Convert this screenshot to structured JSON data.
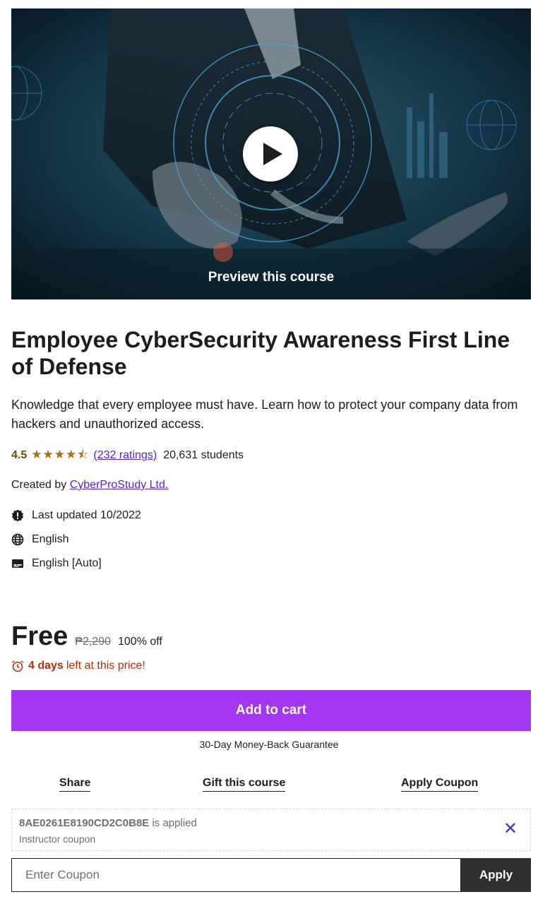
{
  "preview": {
    "label": "Preview this course"
  },
  "course": {
    "title": "Employee CyberSecurity Awareness First Line of Defense",
    "subtitle": "Knowledge that every employee must have. Learn how to protect your company data from hackers and unauthorized access.",
    "rating": "4.5",
    "rating_value": 4.5,
    "ratings_count": "(232 ratings)",
    "students": "20,631 students",
    "created_by_label": "Created by",
    "instructor": "CyberProStudy Ltd.",
    "last_updated": "Last updated 10/2022",
    "language": "English",
    "captions": "English [Auto]"
  },
  "pricing": {
    "price": "Free",
    "original_price": "₱2,290",
    "discount": "100% off",
    "countdown_bold": "4 days",
    "countdown_rest": "left at this price!"
  },
  "buttons": {
    "add_to_cart": "Add to cart",
    "guarantee": "30-Day Money-Back Guarantee",
    "share": "Share",
    "gift": "Gift this course",
    "apply_coupon": "Apply Coupon"
  },
  "coupon": {
    "code": "8AE0261E8190CD2C0B8E",
    "applied_text": "is applied",
    "type": "Instructor coupon",
    "input_placeholder": "Enter Coupon",
    "apply_label": "Apply"
  },
  "colors": {
    "accent": "#a435f0",
    "link": "#5624d0",
    "star": "#b4690e",
    "countdown": "#b32d0f"
  },
  "icons": [
    "play-icon",
    "star-icon",
    "alert-badge-icon",
    "globe-icon",
    "captions-icon",
    "alarm-icon",
    "close-icon"
  ]
}
